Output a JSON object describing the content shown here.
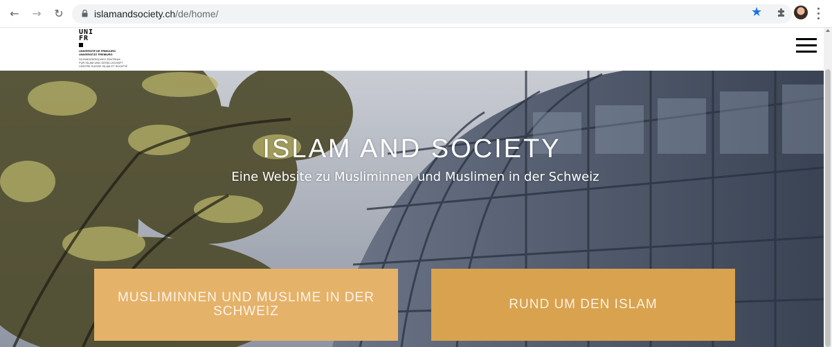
{
  "browser": {
    "url_domain": "islamandsociety.ch",
    "url_path": "/de/home/",
    "back_icon": "arrow-left",
    "forward_icon": "arrow-right",
    "reload_icon": "reload",
    "bookmark_icon": "star",
    "extensions_icon": "puzzle",
    "menu_icon": "kebab",
    "accent_color": "#1a73e8"
  },
  "header": {
    "logo_mark_line1": "UNI",
    "logo_mark_line2": "FR",
    "logo_university": "UNIVERSITÉ DE FRIBOURG\nUNIVERSITÄT FREIBURG",
    "logo_center": "SCHWEIZERISCHES ZENTRUM\nFÜR ISLAM UND GESELLSCHAFT\nCENTRE SUISSE ISLAM ET SOCIÉTÉ",
    "menu_icon": "hamburger"
  },
  "hero": {
    "title": "ISLAM AND SOCIETY",
    "subtitle": "Eine Website zu Musliminnen und Muslimen in der Schweiz",
    "buttons": [
      {
        "label": "MUSLIMINNEN UND MUSLIME IN DER SCHWEIZ",
        "color": "#e5b26a"
      },
      {
        "label": "RUND UM DEN ISLAM",
        "color": "#d9a24e"
      }
    ]
  }
}
